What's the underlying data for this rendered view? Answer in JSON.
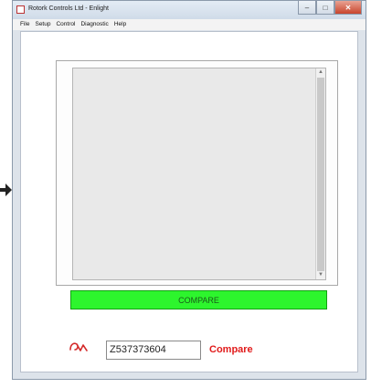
{
  "window": {
    "title": "Rotork Controls Ltd - Enlight",
    "min_label": "–",
    "max_label": "□",
    "close_label": "✕"
  },
  "menu": [
    "File",
    "Setup",
    "Control",
    "Diagnostic",
    "Help"
  ],
  "main": {
    "compare_button": "COMPARE",
    "serial_number": "Z537373604",
    "compare_link": "Compare",
    "scroll_up": "▲",
    "scroll_down": "▼"
  },
  "colors": {
    "compare_button_bg": "#2df52d",
    "compare_link": "#e11b1b",
    "logo": "#d42a2a"
  },
  "icons": {
    "pointer": "arrow-right-icon",
    "logo": "rotork-logo-icon"
  }
}
